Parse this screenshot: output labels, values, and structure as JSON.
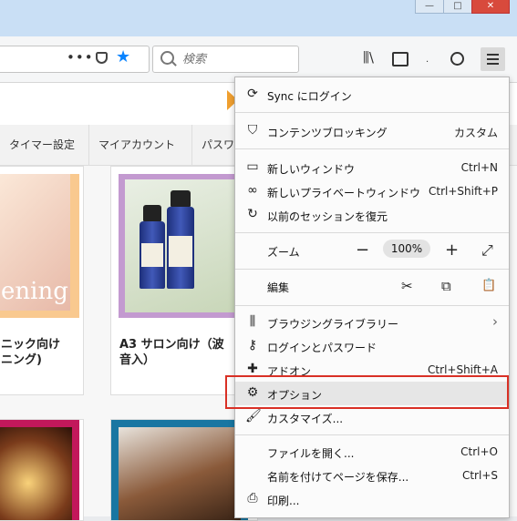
{
  "window": {
    "minimize": "—",
    "maximize": "□",
    "close": "✕"
  },
  "toolbar": {
    "url_dots": "•••",
    "search_placeholder": "検索",
    "icons": [
      "library-icon",
      "sidebar-icon",
      "account-icon",
      "menu-icon"
    ]
  },
  "site": {
    "nav": [
      "タイマー設定",
      "マイアカウント",
      "パスワ"
    ],
    "cards": [
      {
        "title_line1": "ニック向け",
        "title_line2": "ニング)",
        "image_text": "ening"
      },
      {
        "title_line1": "A3 サロン向け（波",
        "title_line2": "音入）"
      }
    ]
  },
  "menu": {
    "items": [
      {
        "icon": "sync-icon",
        "glyph": "⟳",
        "label": "Sync にログイン",
        "shortcut": ""
      },
      {
        "icon": "shield-icon",
        "glyph": "⛉",
        "label": "コンテンツブロッキング",
        "shortcut": "カスタム"
      },
      {
        "icon": "new-window-icon",
        "glyph": "▭",
        "label": "新しいウィンドウ",
        "shortcut": "Ctrl+N"
      },
      {
        "icon": "private-mask-icon",
        "glyph": "∞",
        "label": "新しいプライベートウィンドウ",
        "shortcut": "Ctrl+Shift+P"
      },
      {
        "icon": "restore-session-icon",
        "glyph": "↻",
        "label": "以前のセッションを復元",
        "shortcut": ""
      },
      {
        "icon": "",
        "glyph": "",
        "label": "ズーム",
        "shortcut": ""
      },
      {
        "icon": "",
        "glyph": "",
        "label": "編集",
        "shortcut": ""
      },
      {
        "icon": "library-icon",
        "glyph": "⫼",
        "label": "ブラウジングライブラリー",
        "shortcut": "›"
      },
      {
        "icon": "key-icon",
        "glyph": "⚷",
        "label": "ログインとパスワード",
        "shortcut": ""
      },
      {
        "icon": "puzzle-icon",
        "glyph": "✚",
        "label": "アドオン",
        "shortcut": "Ctrl+Shift+A"
      },
      {
        "icon": "gear-icon",
        "glyph": "⚙",
        "label": "オプション",
        "shortcut": ""
      },
      {
        "icon": "brush-icon",
        "glyph": "🖌",
        "label": "カスタマイズ...",
        "shortcut": ""
      },
      {
        "icon": "",
        "glyph": "",
        "label": "ファイルを開く...",
        "shortcut": "Ctrl+O"
      },
      {
        "icon": "",
        "glyph": "",
        "label": "名前を付けてページを保存...",
        "shortcut": "Ctrl+S"
      },
      {
        "icon": "print-icon",
        "glyph": "⎙",
        "label": "印刷...",
        "shortcut": ""
      }
    ],
    "zoom": {
      "minus": "−",
      "value": "100%",
      "plus": "+",
      "fullscreen": "⤢"
    },
    "edit": {
      "cut": "✂",
      "copy": "⧉",
      "paste": "📋"
    },
    "highlighted_item": "オプション"
  }
}
